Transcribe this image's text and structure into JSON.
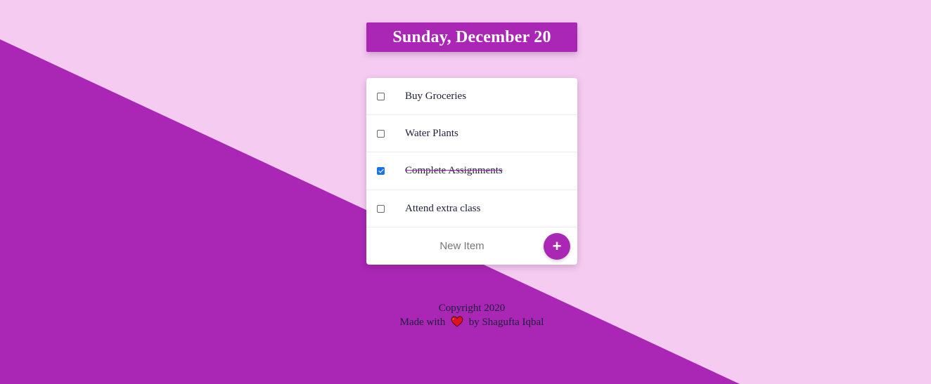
{
  "header": {
    "date_title": "Sunday, December 20"
  },
  "todo": {
    "items": [
      {
        "label": "Buy Groceries",
        "checked": false
      },
      {
        "label": "Water Plants",
        "checked": false
      },
      {
        "label": "Complete Assignments",
        "checked": true
      },
      {
        "label": "Attend extra class",
        "checked": false
      }
    ],
    "new_item": {
      "placeholder": "New Item",
      "add_label": "+"
    }
  },
  "footer": {
    "copyright": "Copyright 2020",
    "made_with": "Made with",
    "heart_icon": "heart-icon",
    "by_author": "by Shagufta Iqbal"
  },
  "colors": {
    "accent": "#a927b4",
    "background_light": "#f5cbf1",
    "text": "#1e1e3c"
  }
}
